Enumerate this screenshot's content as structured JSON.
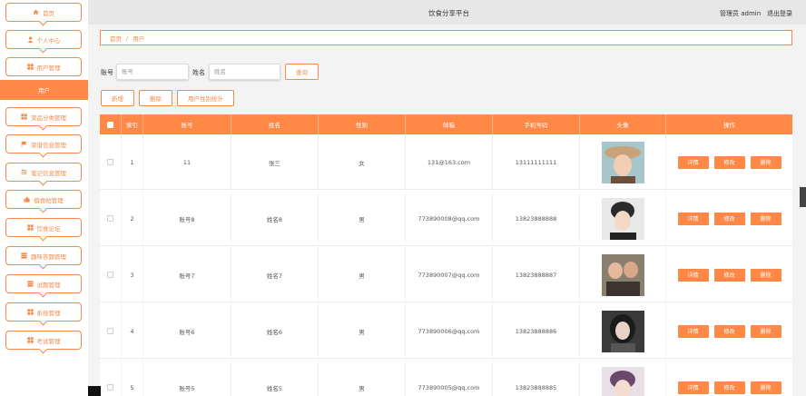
{
  "header": {
    "title": "饮食分享平台",
    "user": "管理员 admin",
    "logout": "退出登录"
  },
  "sidebar": {
    "items": [
      {
        "label": "首页",
        "icon": "home-icon"
      },
      {
        "label": "个人中心",
        "icon": "person-icon"
      },
      {
        "label": "用户管理",
        "icon": "grid-icon"
      },
      {
        "label": "菜品分类管理",
        "icon": "grid-icon"
      },
      {
        "label": "菜谱信息管理",
        "icon": "flag-icon"
      },
      {
        "label": "笔记信息管理",
        "icon": "sliders-icon"
      },
      {
        "label": "偏食帖管理",
        "icon": "thumb-icon"
      },
      {
        "label": "饮食论坛",
        "icon": "grid-icon"
      },
      {
        "label": "趣味答题管理",
        "icon": "stack-icon"
      },
      {
        "label": "试题管理",
        "icon": "stack-icon"
      },
      {
        "label": "系统管理",
        "icon": "grid-icon"
      },
      {
        "label": "考试管理",
        "icon": "grid-icon"
      }
    ],
    "active_sub": "用户"
  },
  "breadcrumb": {
    "home": "首页",
    "separator": "/",
    "current": "用户"
  },
  "search": {
    "account_label": "账号",
    "account_placeholder": "账号",
    "name_label": "姓名",
    "name_placeholder": "姓名",
    "query_button": "查询"
  },
  "toolbar": {
    "add": "新增",
    "delete": "删除",
    "stats": "用户性别统计"
  },
  "table": {
    "headers": [
      "",
      "索引",
      "账号",
      "姓名",
      "性别",
      "邮箱",
      "手机号码",
      "头像",
      "操作"
    ],
    "actions": [
      "详情",
      "修改",
      "删除"
    ],
    "rows": [
      {
        "index": "1",
        "account": "11",
        "name": "张三",
        "gender": "女",
        "email": "131@163.com",
        "phone": "13111111111"
      },
      {
        "index": "2",
        "account": "账号8",
        "name": "姓名8",
        "gender": "男",
        "email": "773890008@qq.com",
        "phone": "13823888888"
      },
      {
        "index": "3",
        "account": "账号7",
        "name": "姓名7",
        "gender": "男",
        "email": "773890007@qq.com",
        "phone": "13823888887"
      },
      {
        "index": "4",
        "account": "账号6",
        "name": "姓名6",
        "gender": "男",
        "email": "773890006@qq.com",
        "phone": "13823888886"
      },
      {
        "index": "5",
        "account": "账号5",
        "name": "姓名5",
        "gender": "男",
        "email": "773890005@qq.com",
        "phone": "13823888885"
      }
    ]
  },
  "colors": {
    "accent": "#ff8847",
    "accent_border": "#f58a4a",
    "header_bg": "#e7e7e7"
  }
}
